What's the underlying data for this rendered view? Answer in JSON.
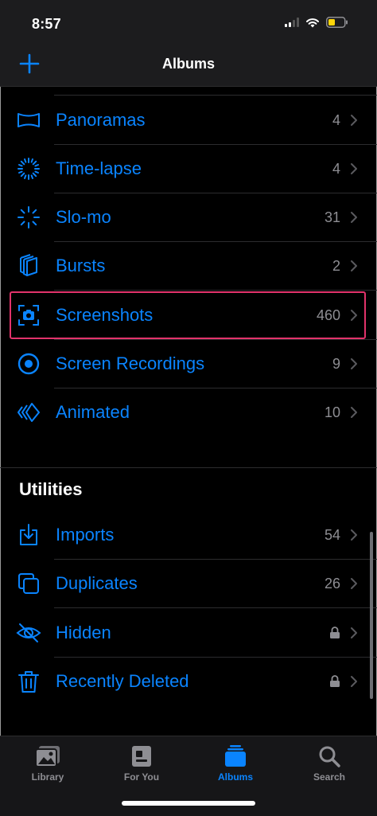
{
  "status": {
    "time": "8:57"
  },
  "nav": {
    "title": "Albums"
  },
  "media_types": [
    {
      "label": "Panoramas",
      "count": "4",
      "icon": "panorama-icon"
    },
    {
      "label": "Time-lapse",
      "count": "4",
      "icon": "timelapse-icon"
    },
    {
      "label": "Slo-mo",
      "count": "31",
      "icon": "slomo-icon"
    },
    {
      "label": "Bursts",
      "count": "2",
      "icon": "bursts-icon"
    },
    {
      "label": "Screenshots",
      "count": "460",
      "icon": "screenshot-icon"
    },
    {
      "label": "Screen Recordings",
      "count": "9",
      "icon": "screen-recording-icon"
    },
    {
      "label": "Animated",
      "count": "10",
      "icon": "animated-icon"
    }
  ],
  "utilities": {
    "title": "Utilities",
    "items": [
      {
        "label": "Imports",
        "count": "54",
        "icon": "imports-icon"
      },
      {
        "label": "Duplicates",
        "count": "26",
        "icon": "duplicates-icon"
      },
      {
        "label": "Hidden",
        "count": "",
        "icon": "hidden-eye-icon",
        "locked": true
      },
      {
        "label": "Recently Deleted",
        "count": "",
        "icon": "trash-icon",
        "locked": true
      }
    ]
  },
  "tabs": [
    {
      "label": "Library",
      "icon": "library-icon"
    },
    {
      "label": "For You",
      "icon": "for-you-icon"
    },
    {
      "label": "Albums",
      "icon": "albums-icon",
      "active": true
    },
    {
      "label": "Search",
      "icon": "search-icon"
    }
  ],
  "colors": {
    "accent": "#0a84ff",
    "highlight": "#e2336b",
    "secondary": "#8e8e93"
  }
}
